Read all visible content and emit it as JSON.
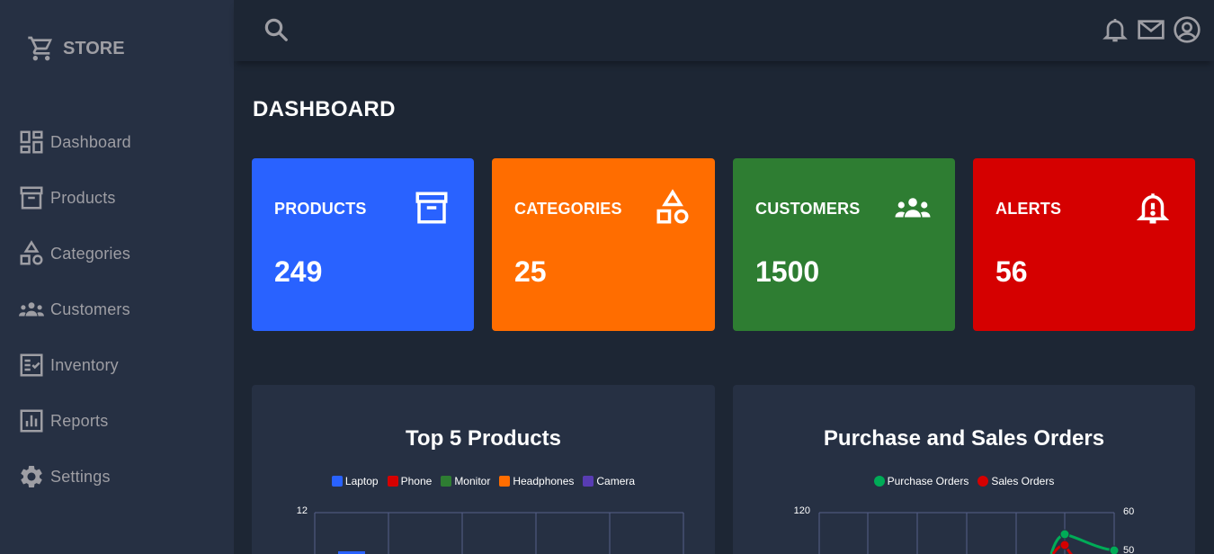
{
  "brand": {
    "name": "STORE",
    "icon": "cart-icon"
  },
  "sidebar": {
    "items": [
      {
        "label": "Dashboard",
        "icon": "dashboard-icon"
      },
      {
        "label": "Products",
        "icon": "archive-icon"
      },
      {
        "label": "Categories",
        "icon": "shapes-icon"
      },
      {
        "label": "Customers",
        "icon": "people-icon"
      },
      {
        "label": "Inventory",
        "icon": "checklist-icon"
      },
      {
        "label": "Reports",
        "icon": "bar-chart-icon"
      },
      {
        "label": "Settings",
        "icon": "gear-icon"
      }
    ]
  },
  "header": {
    "icons": [
      "search-icon",
      "bell-icon",
      "mail-icon",
      "account-icon"
    ]
  },
  "main": {
    "title": "DASHBOARD"
  },
  "cards": [
    {
      "title": "PRODUCTS",
      "value": "249",
      "color": "#2962ff",
      "icon": "archive-icon"
    },
    {
      "title": "CATEGORIES",
      "value": "25",
      "color": "#ff6d00",
      "icon": "shapes-icon"
    },
    {
      "title": "CUSTOMERS",
      "value": "1500",
      "color": "#2e7d32",
      "icon": "people-icon"
    },
    {
      "title": "ALERTS",
      "value": "56",
      "color": "#d50000",
      "icon": "alert-bell-icon"
    }
  ],
  "chart_data": [
    {
      "type": "bar",
      "title": "Top 5 Products",
      "legend": [
        {
          "name": "Laptop",
          "color": "#2962ff"
        },
        {
          "name": "Phone",
          "color": "#d50000"
        },
        {
          "name": "Monitor",
          "color": "#2e7d32"
        },
        {
          "name": "Headphones",
          "color": "#ff6d00"
        },
        {
          "name": "Camera",
          "color": "#583cb3"
        }
      ],
      "y_ticks_visible": [
        "12"
      ],
      "ylim_top": 12,
      "grid": true
    },
    {
      "type": "line",
      "title": "Purchase and Sales Orders",
      "legend": [
        {
          "name": "Purchase Orders",
          "color": "#00ab57"
        },
        {
          "name": "Sales Orders",
          "color": "#d50000"
        }
      ],
      "y_left_ticks_visible": [
        "120"
      ],
      "y_right_ticks_visible": [
        "60",
        "50"
      ],
      "grid": true
    }
  ]
}
